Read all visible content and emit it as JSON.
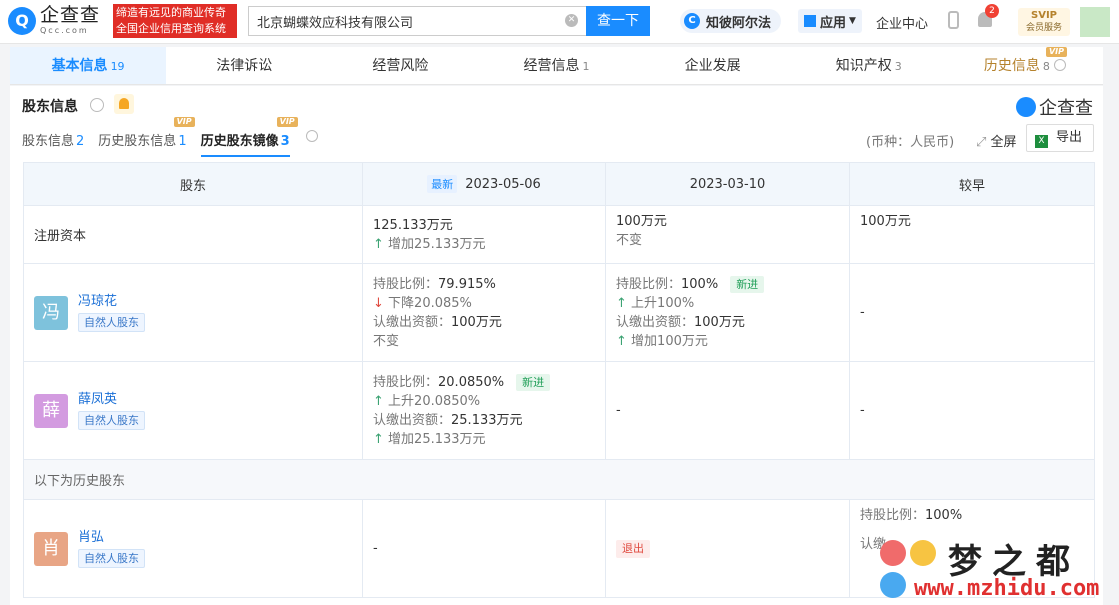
{
  "header": {
    "logo_cn": "企查查",
    "logo_en": "Qcc.com",
    "slogan_line1": "缔造有远见的商业传奇",
    "slogan_line2": "全国企业信用查询系统",
    "search_value": "北京蝴蝶效应科技有限公司",
    "search_button": "查一下",
    "zhibei_label": "知彼阿尔法",
    "apps_label": "应用",
    "enterprise_center": "企业中心",
    "notification_count": "2",
    "svip_line1": "SVIP",
    "svip_line2": "会员服务"
  },
  "tabs": [
    {
      "label": "基本信息",
      "count": "19"
    },
    {
      "label": "法律诉讼",
      "count": ""
    },
    {
      "label": "经营风险",
      "count": ""
    },
    {
      "label": "经营信息",
      "count": "1"
    },
    {
      "label": "企业发展",
      "count": ""
    },
    {
      "label": "知识产权",
      "count": "3"
    },
    {
      "label": "历史信息",
      "count": "8",
      "badge": "VIP"
    }
  ],
  "section": {
    "title": "股东信息",
    "brand": "企查查",
    "subtabs": [
      {
        "label": "股东信息",
        "count": "2"
      },
      {
        "label": "历史股东信息",
        "count": "1",
        "badge": "VIP"
      },
      {
        "label": "历史股东镜像",
        "count": "3",
        "badge": "VIP"
      }
    ],
    "currency": "(币种：人民币)",
    "fullscreen": "全屏",
    "export": "导出"
  },
  "table": {
    "headers": {
      "shareholder": "股东",
      "newest_tag": "最新",
      "date1": "2023-05-06",
      "date2": "2023-03-10",
      "date3": "较早"
    },
    "capital": {
      "label": "注册资本",
      "c1_value": "125.133万元",
      "c1_change": "增加25.133万元",
      "c2_value": "100万元",
      "c2_change": "不变",
      "c3_value": "100万元"
    },
    "feng": {
      "avatar": "冯",
      "name": "冯琼花",
      "type": "自然人股东",
      "c1_ratio_label": "持股比例：",
      "c1_ratio": "79.915%",
      "c1_ratio_change": "下降20.085%",
      "c1_cap_label": "认缴出资额：",
      "c1_cap": "100万元",
      "c1_cap_change": "不变",
      "c2_ratio_label": "持股比例：",
      "c2_ratio": "100%",
      "c2_tag": "新进",
      "c2_ratio_change": "上升100%",
      "c2_cap_label": "认缴出资额：",
      "c2_cap": "100万元",
      "c2_cap_change": "增加100万元",
      "c3": "-"
    },
    "xue": {
      "avatar": "薛",
      "name": "薛凤英",
      "type": "自然人股东",
      "c1_ratio_label": "持股比例：",
      "c1_ratio": "20.0850%",
      "c1_tag": "新进",
      "c1_ratio_change": "上升20.0850%",
      "c1_cap_label": "认缴出资额：",
      "c1_cap": "25.133万元",
      "c1_cap_change": "增加25.133万元",
      "c2": "-",
      "c3": "-"
    },
    "history_label": "以下为历史股东",
    "xiao": {
      "avatar": "肖",
      "name": "肖弘",
      "type": "自然人股东",
      "c1": "-",
      "c2_tag": "退出",
      "c3_ratio_label": "持股比例：",
      "c3_ratio": "100%",
      "c3_cap_label": "认缴"
    }
  },
  "watermark": {
    "title": "梦之都",
    "url": "www.mzhidu.com"
  }
}
